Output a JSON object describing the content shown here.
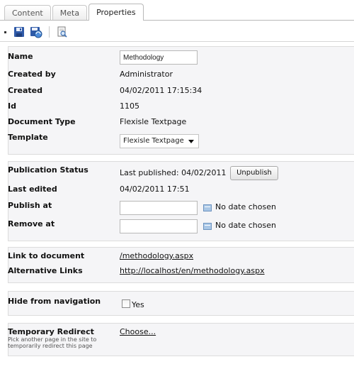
{
  "tabs": [
    {
      "label": "Content",
      "active": false
    },
    {
      "label": "Meta",
      "active": false
    },
    {
      "label": "Properties",
      "active": true
    }
  ],
  "toolbar": {
    "icons": [
      "save-icon",
      "save-and-publish-icon",
      "preview-icon"
    ]
  },
  "properties": {
    "name_label": "Name",
    "name_value": "Methodology",
    "created_by_label": "Created by",
    "created_by_value": "Administrator",
    "created_label": "Created",
    "created_value": "04/02/2011 17:15:34",
    "id_label": "Id",
    "id_value": "1105",
    "doc_type_label": "Document Type",
    "doc_type_value": "Flexisle Textpage",
    "template_label": "Template",
    "template_value": "Flexisle Textpage"
  },
  "publication": {
    "status_label": "Publication Status",
    "status_value": "Last published: 04/02/2011",
    "unpublish_label": "Unpublish",
    "last_edited_label": "Last edited",
    "last_edited_value": "04/02/2011 17:51",
    "publish_at_label": "Publish at",
    "publish_at_value": "",
    "publish_at_nodate": "No date chosen",
    "remove_at_label": "Remove at",
    "remove_at_value": "",
    "remove_at_nodate": "No date chosen"
  },
  "links": {
    "link_label": "Link to document",
    "link_value": "/methodology.aspx",
    "alt_label": "Alternative Links",
    "alt_value": "http://localhost/en/methodology.aspx"
  },
  "navigation": {
    "hide_label": "Hide from navigation",
    "hide_option": "Yes",
    "hide_checked": false
  },
  "redirect": {
    "label": "Temporary Redirect",
    "description": "Pick another page in the site to temporarily redirect this page",
    "choose_label": "Choose..."
  },
  "colors": {
    "panel_bg": "#f5f5f7",
    "panel_border": "#dcdcdc",
    "calendar_blue": "#a9c7e6"
  }
}
